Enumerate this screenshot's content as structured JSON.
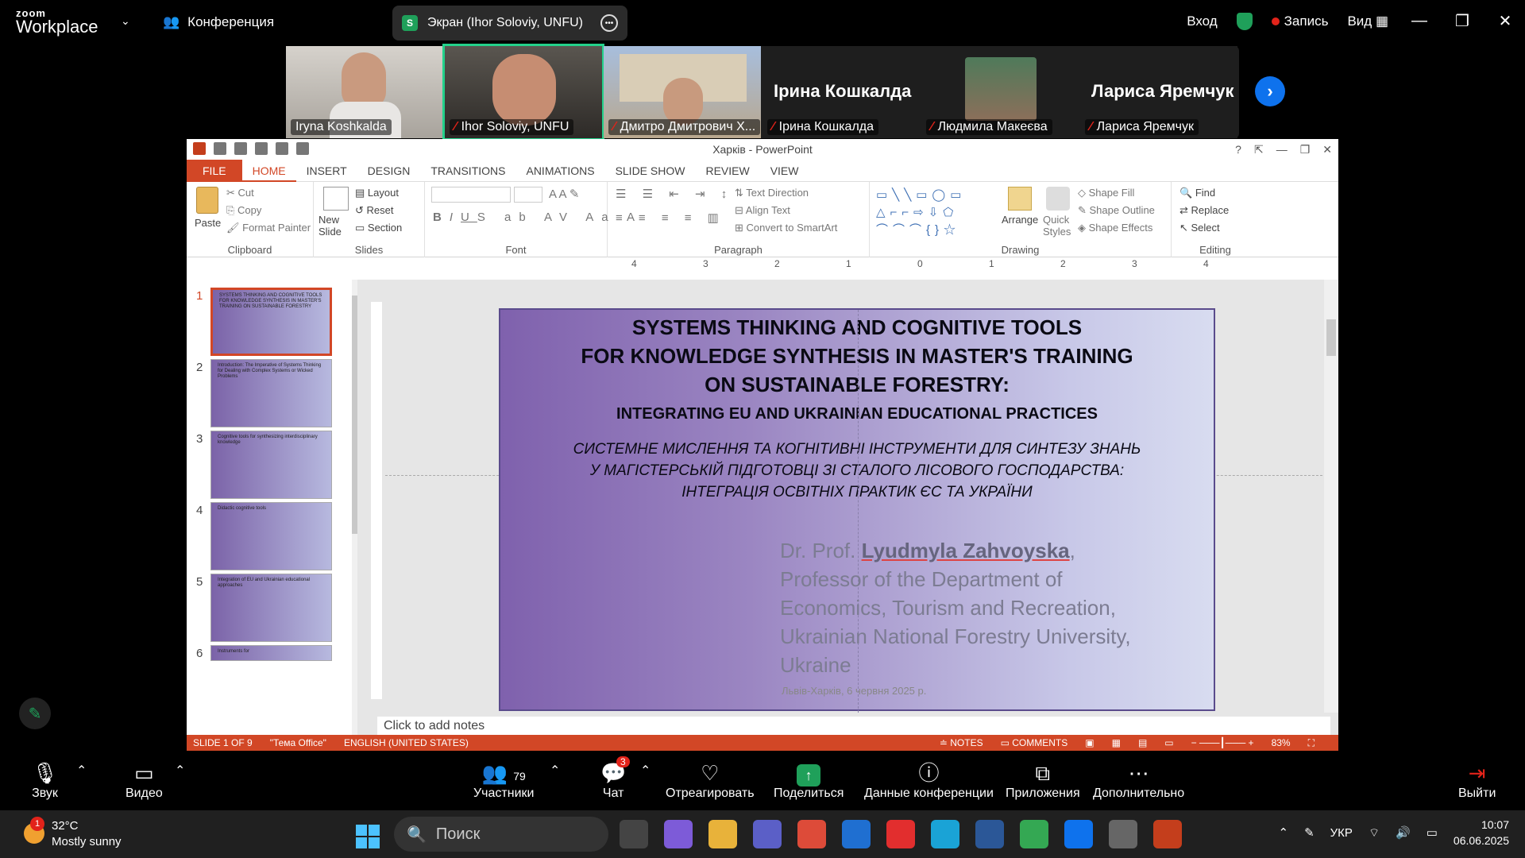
{
  "zoom": {
    "logo_line1": "zoom",
    "logo_line2": "Workplace",
    "conference": "Конференция",
    "screen_share": "Экран (Ihor Soloviy, UNFU)",
    "screen_badge": "S",
    "signin": "Вход",
    "record": "Запись",
    "view": "Вид",
    "participants_strip": [
      {
        "name": "Iryna Koshkalda",
        "muted": false
      },
      {
        "name": "Ihor Soloviy, UNFU",
        "muted": true
      },
      {
        "name": "Дмитро Дмитрович Х...",
        "muted": true
      },
      {
        "name": "Ірина Кошкалда",
        "muted": true,
        "big_label": "Ірина Кошкалда"
      },
      {
        "name": "Людмила Макеєва",
        "muted": true
      },
      {
        "name": "Лариса Яремчук",
        "muted": true,
        "big_label": "Лариса Яремчук"
      }
    ],
    "toolbar": {
      "audio": "Звук",
      "video": "Видео",
      "participants": "Участники",
      "participants_count": "79",
      "chat": "Чат",
      "chat_badge": "3",
      "react": "Отреагировать",
      "share": "Поделиться",
      "meeting_info": "Данные конференции",
      "apps": "Приложения",
      "more": "Дополнительно",
      "leave": "Выйти"
    }
  },
  "ppt": {
    "window_title": "Харків - PowerPoint",
    "tabs": [
      "FILE",
      "HOME",
      "INSERT",
      "DESIGN",
      "TRANSITIONS",
      "ANIMATIONS",
      "SLIDE SHOW",
      "REVIEW",
      "VIEW"
    ],
    "active_tab": "HOME",
    "ribbon": {
      "paste": "Paste",
      "cut": "Cut",
      "copy": "Copy",
      "format_painter": "Format Painter",
      "clipboard": "Clipboard",
      "new_slide": "New Slide",
      "layout": "Layout",
      "reset": "Reset",
      "section": "Section",
      "slides": "Slides",
      "font": "Font",
      "text_direction": "Text Direction",
      "align_text": "Align Text",
      "convert_smartart": "Convert to SmartArt",
      "paragraph": "Paragraph",
      "arrange": "Arrange",
      "quick_styles": "Quick Styles",
      "shape_fill": "Shape Fill",
      "shape_outline": "Shape Outline",
      "shape_effects": "Shape Effects",
      "drawing": "Drawing",
      "find": "Find",
      "replace": "Replace",
      "select": "Select",
      "editing": "Editing"
    },
    "ruler_top": [
      "4",
      "3",
      "2",
      "1",
      "0",
      "1",
      "2",
      "3",
      "4"
    ],
    "thumbnails": [
      {
        "num": "1",
        "text": "SYSTEMS THINKING AND COGNITIVE TOOLS FOR KNOWLEDGE SYNTHESIS IN MASTER'S TRAINING ON SUSTAINABLE FORESTRY"
      },
      {
        "num": "2",
        "text": "Introduction: The Imperative of Systems Thinking for Dealing with Complex Systems or Wicked Problems"
      },
      {
        "num": "3",
        "text": "Cognitive tools for synthesizing interdisciplinary knowledge"
      },
      {
        "num": "4",
        "text": "Didactic cognitive tools"
      },
      {
        "num": "5",
        "text": "Integration of EU and Ukrainian educational approaches"
      },
      {
        "num": "6",
        "text": "Instruments for"
      }
    ],
    "slide": {
      "title_lines": [
        "SYSTEMS THINKING AND COGNITIVE TOOLS",
        "FOR KNOWLEDGE SYNTHESIS IN MASTER'S TRAINING",
        "ON SUSTAINABLE FORESTRY:"
      ],
      "subtitle": "INTEGRATING EU AND UKRAINIAN EDUCATIONAL PRACTICES",
      "ua_lines": [
        "СИСТЕМНЕ МИСЛЕННЯ ТА КОГНІТИВНІ ІНСТРУМЕНТИ ДЛЯ СИНТЕЗУ ЗНАНЬ",
        "У МАГІСТЕРСЬКІЙ ПІДГОТОВЦІ ЗІ СТАЛОГО ЛІСОВОГО ГОСПОДАРСТВА:",
        "ІНТЕГРАЦІЯ ОСВІТНІХ ПРАКТИК ЄС ТА УКРАЇНИ"
      ],
      "author_prefix": "Dr. Prof. ",
      "author_name": "Lyudmyla Zahvoyska",
      "author_suffix": ",",
      "affiliation_lines": [
        "Professor of the Department of",
        "Economics, Tourism and Recreation,",
        "Ukrainian National Forestry University,",
        "Ukraine"
      ],
      "date": "Львів-Харків, 6 червня 2025 р."
    },
    "notes_placeholder": "Click to add notes",
    "status": {
      "slide": "SLIDE 1 OF 9",
      "theme": "\"Тема Office\"",
      "language": "ENGLISH (UNITED STATES)",
      "notes": "NOTES",
      "comments": "COMMENTS",
      "zoom": "83%"
    }
  },
  "taskbar": {
    "temperature": "32°C",
    "weather": "Mostly sunny",
    "weather_badge": "1",
    "search": "Поиск",
    "language": "УКР",
    "time": "10:07",
    "date": "06.06.2025"
  },
  "colors": {
    "ppt_accent": "#D24726",
    "zoom_blue": "#0E72ED",
    "zoom_green": "#1FA05A",
    "record_red": "#E2231A"
  }
}
